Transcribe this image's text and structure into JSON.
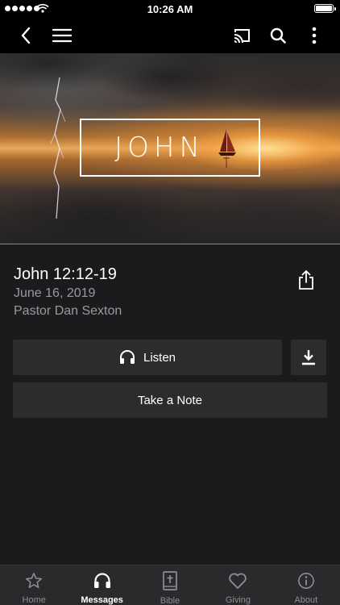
{
  "status_bar": {
    "time": "10:26 AM",
    "signal_bars": 5
  },
  "app_bar": {
    "icons": [
      "back-icon",
      "menu-icon",
      "cast-icon",
      "search-icon",
      "more-icon"
    ]
  },
  "hero": {
    "title": "JOHN"
  },
  "message": {
    "title": "John 12:12-19",
    "date": "June 16, 2019",
    "speaker": "Pastor Dan Sexton"
  },
  "actions": {
    "listen_label": "Listen",
    "note_label": "Take a Note"
  },
  "tabs": [
    {
      "label": "Home",
      "icon": "star-icon",
      "active": false
    },
    {
      "label": "Messages",
      "icon": "headphones-icon",
      "active": true
    },
    {
      "label": "Bible",
      "icon": "bible-icon",
      "active": false
    },
    {
      "label": "Giving",
      "icon": "heart-icon",
      "active": false
    },
    {
      "label": "About",
      "icon": "info-icon",
      "active": false
    }
  ],
  "colors": {
    "background": "#1b1b1d",
    "button": "#2c2c2e",
    "secondary_text": "#9a9a9e",
    "tab_inactive": "#8e8e93",
    "tab_active": "#ffffff"
  }
}
